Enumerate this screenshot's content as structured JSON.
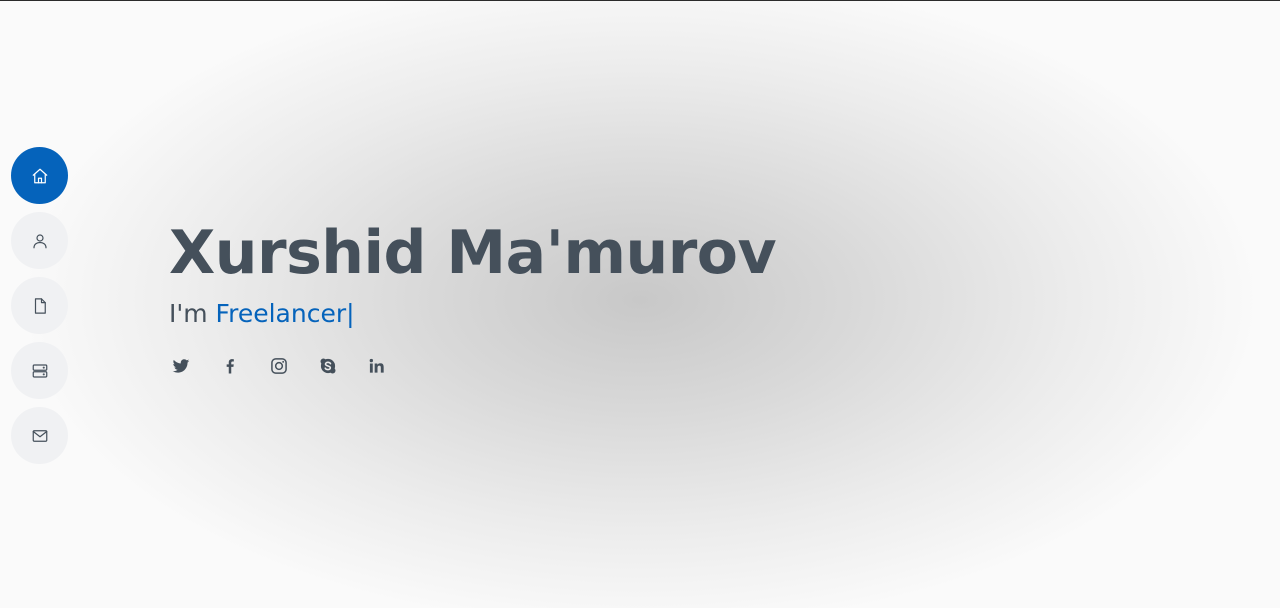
{
  "nav": {
    "items": [
      {
        "name": "home",
        "icon": "home-icon",
        "active": true
      },
      {
        "name": "about",
        "icon": "user-icon",
        "active": false
      },
      {
        "name": "resume",
        "icon": "file-icon",
        "active": false
      },
      {
        "name": "services",
        "icon": "server-icon",
        "active": false
      },
      {
        "name": "contact",
        "icon": "envelope-icon",
        "active": false
      }
    ]
  },
  "hero": {
    "name": "Xurshid Ma'murov",
    "prefix": "I'm ",
    "role": "Freelancer",
    "caret": "|"
  },
  "social": [
    "twitter-icon",
    "facebook-icon",
    "instagram-icon",
    "skype-icon",
    "linkedin-icon"
  ],
  "colors": {
    "accent": "#0563bb",
    "text": "#45505b",
    "nav_bg": "#f0f1f3"
  }
}
